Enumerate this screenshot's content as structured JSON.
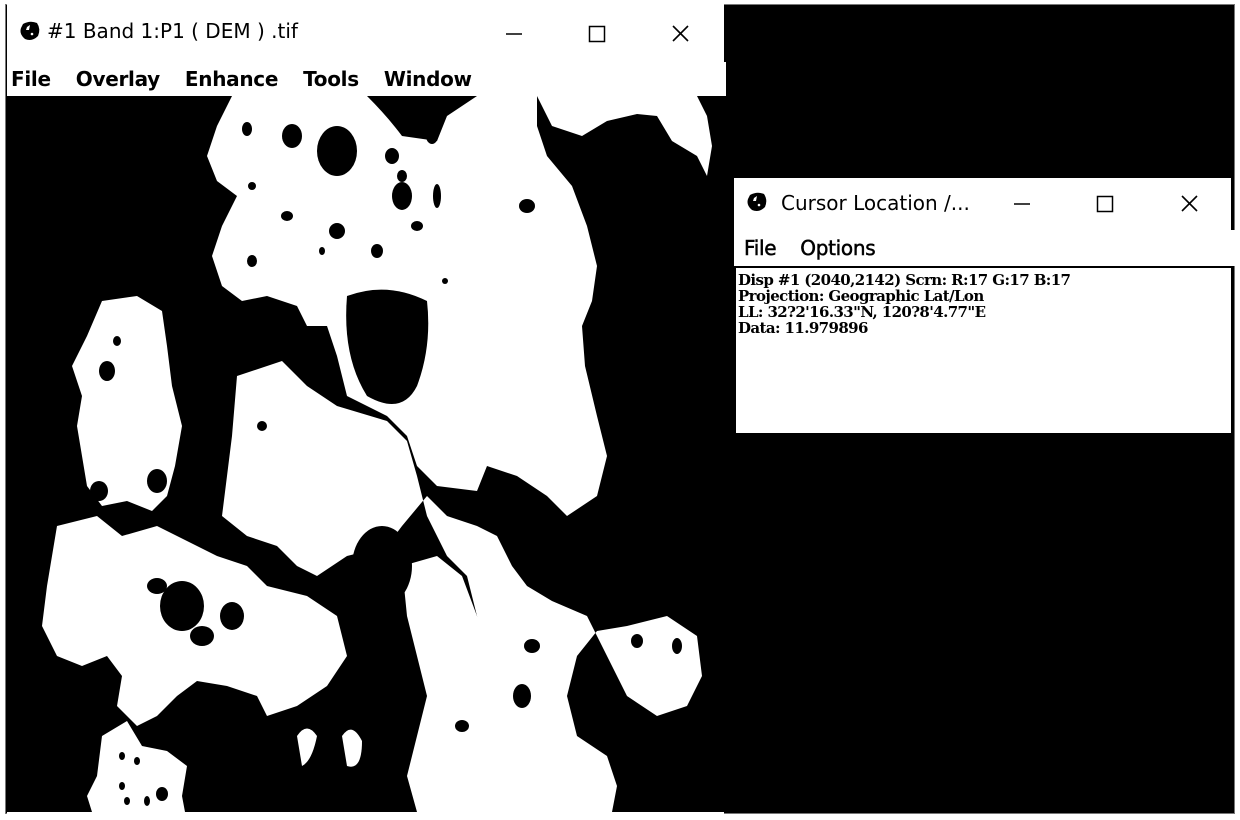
{
  "main_window": {
    "title": "#1 Band 1:P1 ( DEM ) .tif",
    "icon": "envi-globe-icon",
    "controls": {
      "minimize": "minimize-icon",
      "maximize": "maximize-icon",
      "close": "close-icon"
    },
    "menu": [
      {
        "label": "File"
      },
      {
        "label": "Overlay"
      },
      {
        "label": "Enhance"
      },
      {
        "label": "Tools"
      },
      {
        "label": "Window"
      }
    ],
    "image": {
      "band": "Band 1",
      "file": "P1 ( DEM ) .tif",
      "render": "binary black/white thresholded DEM"
    }
  },
  "cursor_window": {
    "title": "Cursor Location /...",
    "icon": "envi-globe-icon",
    "controls": {
      "minimize": "minimize-icon",
      "maximize": "maximize-icon",
      "close": "close-icon"
    },
    "menu": [
      {
        "label": "File"
      },
      {
        "label": "Options"
      }
    ],
    "readout": {
      "line1": "Disp #1 (2040,2142) Scrn: R:17 G:17 B:17",
      "line2": "Projection: Geographic Lat/Lon",
      "line3": "LL: 32?2'16.33\"N, 120?8'4.77\"E",
      "line4": "Data: 11.979896"
    }
  },
  "colors": {
    "background": "#000000",
    "window": "#ffffff",
    "text": "#000000"
  }
}
